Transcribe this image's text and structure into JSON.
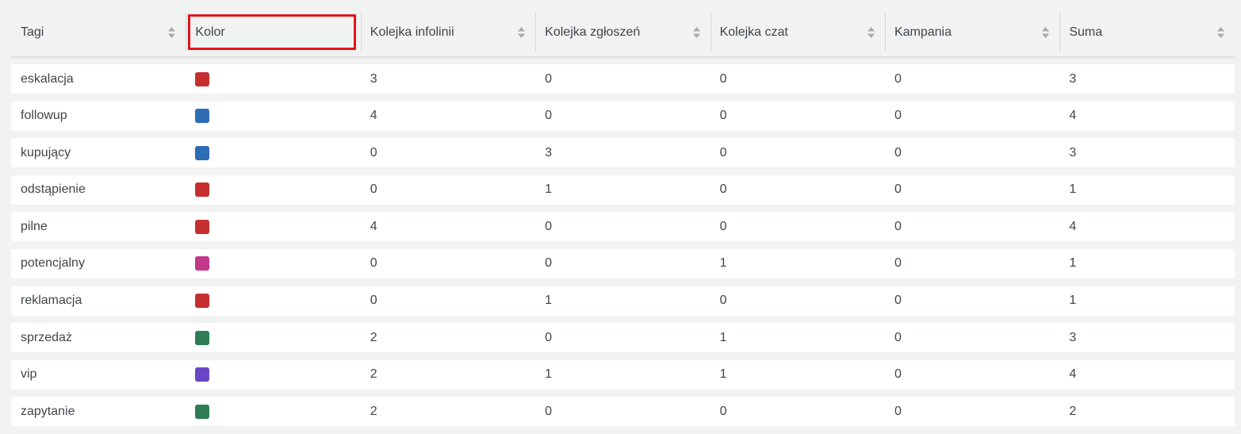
{
  "table": {
    "columns": [
      {
        "label": "Tagi",
        "sortable": true
      },
      {
        "label": "Kolor",
        "sortable": false
      },
      {
        "label": "Kolejka infolinii",
        "sortable": true
      },
      {
        "label": "Kolejka zgłoszeń",
        "sortable": true
      },
      {
        "label": "Kolejka czat",
        "sortable": true
      },
      {
        "label": "Kampania",
        "sortable": true
      },
      {
        "label": "Suma",
        "sortable": true
      }
    ],
    "highlighted_column": "Kolor",
    "highlight_color": "#e3141b",
    "rows": [
      {
        "tag": "eskalacja",
        "color": "#c62f2f",
        "infolinia": "3",
        "zgloszenia": "0",
        "czat": "0",
        "kampania": "0",
        "suma": "3"
      },
      {
        "tag": "followup",
        "color": "#2e6db4",
        "infolinia": "4",
        "zgloszenia": "0",
        "czat": "0",
        "kampania": "0",
        "suma": "4"
      },
      {
        "tag": "kupujący",
        "color": "#2e6db4",
        "infolinia": "0",
        "zgloszenia": "3",
        "czat": "0",
        "kampania": "0",
        "suma": "3"
      },
      {
        "tag": "odstąpienie",
        "color": "#c62f2f",
        "infolinia": "0",
        "zgloszenia": "1",
        "czat": "0",
        "kampania": "0",
        "suma": "1"
      },
      {
        "tag": "pilne",
        "color": "#c62f2f",
        "infolinia": "4",
        "zgloszenia": "0",
        "czat": "0",
        "kampania": "0",
        "suma": "4"
      },
      {
        "tag": "potencjalny",
        "color": "#c2388a",
        "infolinia": "0",
        "zgloszenia": "0",
        "czat": "1",
        "kampania": "0",
        "suma": "1"
      },
      {
        "tag": "reklamacja",
        "color": "#c62f2f",
        "infolinia": "0",
        "zgloszenia": "1",
        "czat": "0",
        "kampania": "0",
        "suma": "1"
      },
      {
        "tag": "sprzedaż",
        "color": "#2e7d55",
        "infolinia": "2",
        "zgloszenia": "0",
        "czat": "1",
        "kampania": "0",
        "suma": "3"
      },
      {
        "tag": "vip",
        "color": "#6a47c8",
        "infolinia": "2",
        "zgloszenia": "1",
        "czat": "1",
        "kampania": "0",
        "suma": "4"
      },
      {
        "tag": "zapytanie",
        "color": "#2e7d55",
        "infolinia": "2",
        "zgloszenia": "0",
        "czat": "0",
        "kampania": "0",
        "suma": "2"
      }
    ]
  },
  "icons": {
    "sort": "sort-icon"
  },
  "colors": {
    "page_background": "#f1f2f2",
    "row_background": "#ffffff",
    "text": "#3f454a",
    "sort_icon": "#a6abaf"
  }
}
